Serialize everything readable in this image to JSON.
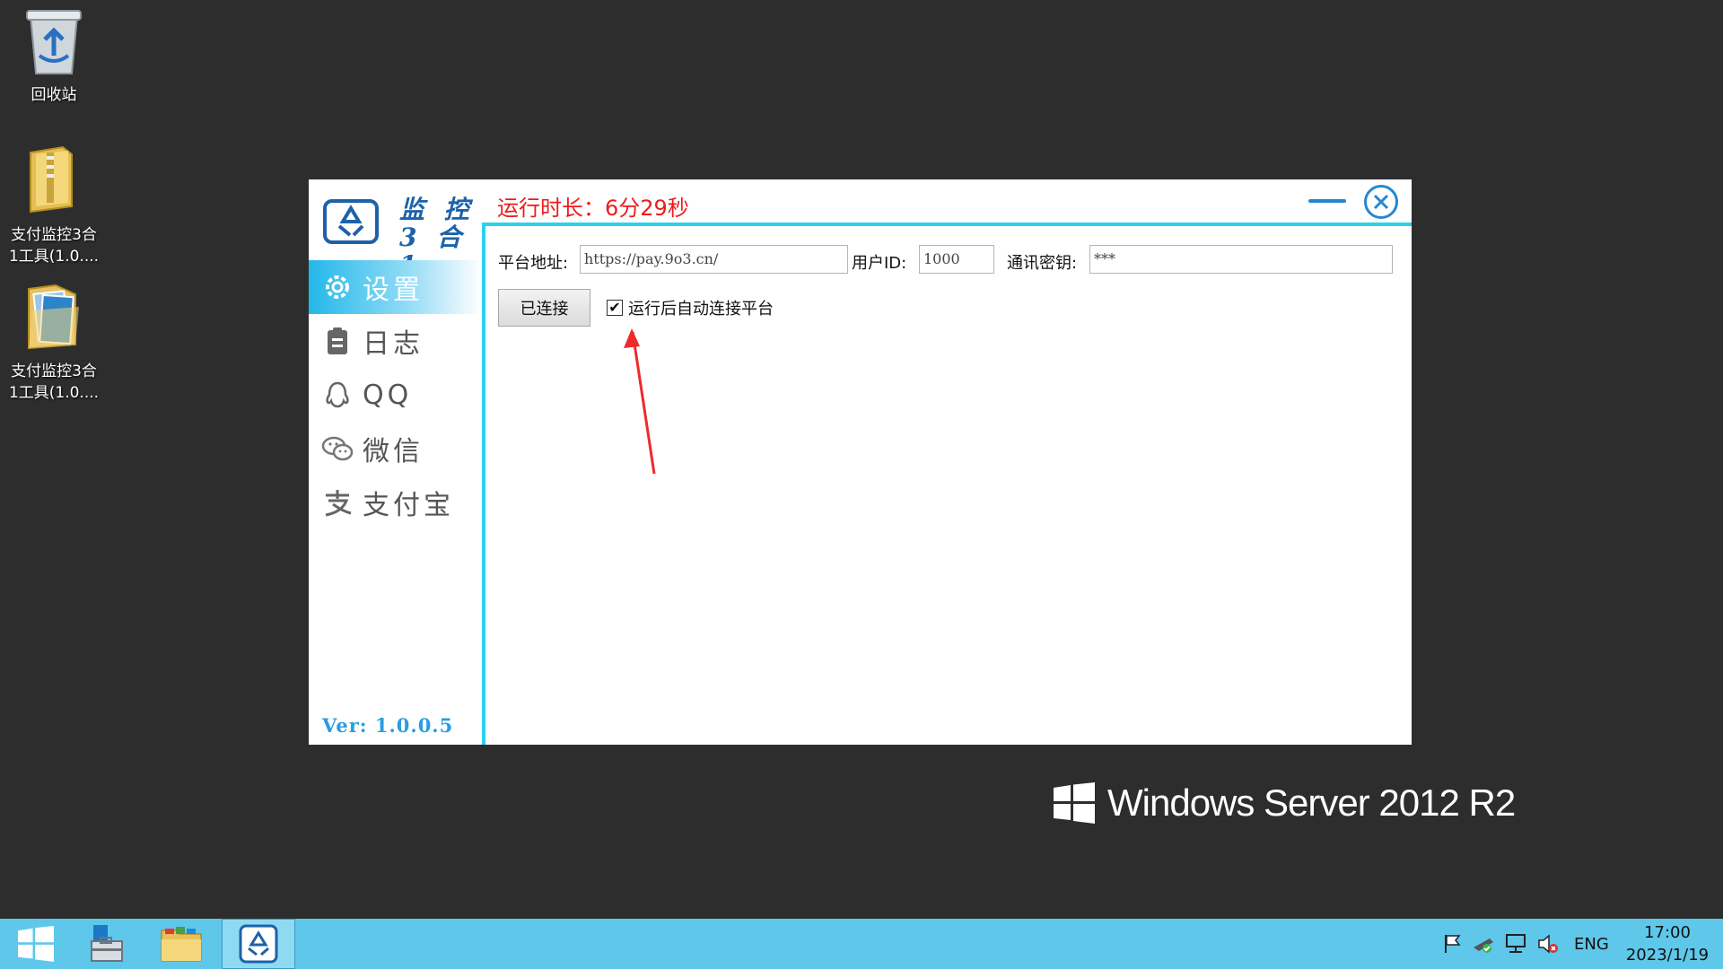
{
  "desktop": {
    "icons": [
      {
        "label": "回收站",
        "icon": "recycle-bin-icon"
      },
      {
        "label": "支付监控3合\n1工具(1.0....",
        "icon": "zip-folder-icon"
      },
      {
        "label": "支付监控3合\n1工具(1.0....",
        "icon": "folder-icon"
      }
    ],
    "watermark": "Windows Server 2012 R2"
  },
  "app": {
    "logo_text_line1": "监 控",
    "logo_text_line2": "3 合 1",
    "runtime": "运行时长：6分29秒",
    "nav": [
      {
        "label": "设置",
        "icon": "gear-icon",
        "active": true
      },
      {
        "label": "日志",
        "icon": "clipboard-icon",
        "active": false
      },
      {
        "label": "QQ",
        "icon": "qq-icon",
        "active": false
      },
      {
        "label": "微信",
        "icon": "wechat-icon",
        "active": false
      },
      {
        "label": "支付宝",
        "icon": "alipay-icon",
        "active": false
      }
    ],
    "version": "Ver: 1.0.0.5",
    "form": {
      "platform_label": "平台地址:",
      "platform_value": "https://pay.9o3.cn/",
      "userid_label": "用户ID:",
      "userid_value": "1000",
      "secret_label": "通讯密钥:",
      "secret_value": "***",
      "connect_button": "已连接",
      "auto_connect_label": "运行后自动连接平台",
      "auto_connect_checked": true
    },
    "accent_color": "#29d1ee",
    "runtime_color": "#ee1b1b"
  },
  "taskbar": {
    "items": [
      "start-icon",
      "server-manager-icon",
      "file-explorer-icon",
      "app-icon"
    ],
    "tray_icons": [
      "flag-icon",
      "network-tool-icon",
      "network-icon",
      "speaker-muted-icon"
    ],
    "language": "ENG",
    "time": "17:00",
    "date": "2023/1/19"
  }
}
